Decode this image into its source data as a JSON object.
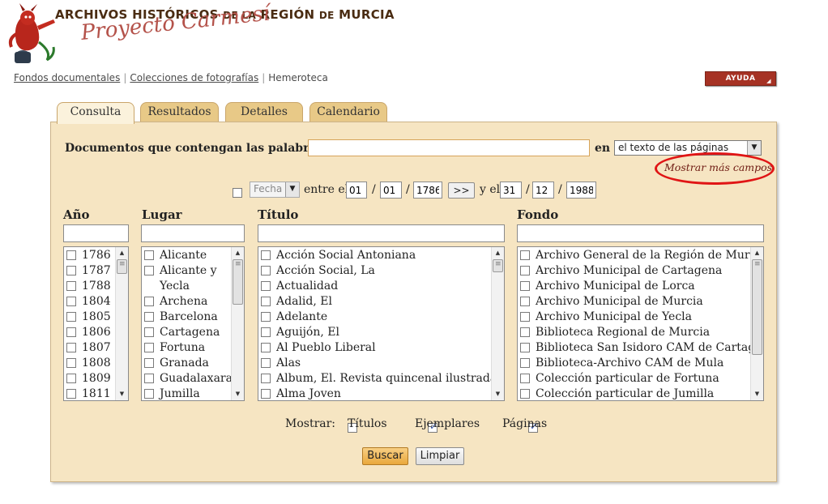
{
  "header": {
    "title_part1": "ARCHIVOS HISTÓRICOS ",
    "title_part2": "DE LA",
    "title_part3": " REGIÓN ",
    "title_part4": "DE",
    "title_part5": " MURCIA",
    "subtitle": "Proyecto Carmesí",
    "logo_icon": "devil-mascot-icon"
  },
  "nav": {
    "links": [
      "Fondos documentales",
      "Colecciones de fotografías",
      "Hemeroteca"
    ],
    "help_label": "AYUDA"
  },
  "tabs": [
    "Consulta",
    "Resultados",
    "Detalles",
    "Calendario"
  ],
  "search": {
    "label": "Documentos que contengan las palabras",
    "query": "",
    "in_label": "en",
    "scope_selected": "el texto de las páginas",
    "more_fields_link": "Mostrar más campos"
  },
  "date_filter": {
    "checked": false,
    "field_select": "Fecha",
    "between_label": "entre el",
    "from": {
      "day": "01",
      "month": "01",
      "year": "1786"
    },
    "sep": "/",
    "arrow_button": ">>",
    "and_label": "y el",
    "to": {
      "day": "31",
      "month": "12",
      "year": "1988"
    }
  },
  "columns": {
    "year": {
      "header": "Año",
      "filter": "",
      "items": [
        "1786",
        "1787",
        "1788",
        "1804",
        "1805",
        "1806",
        "1807",
        "1808",
        "1809",
        "1811"
      ]
    },
    "place": {
      "header": "Lugar",
      "filter": "",
      "items": [
        "Alicante",
        "Alicante y Yecla",
        "Archena",
        "Barcelona",
        "Cartagena",
        "Fortuna",
        "Granada",
        "Guadalaxara",
        "Jumilla"
      ]
    },
    "title": {
      "header": "Título",
      "filter": "",
      "items": [
        "Acción Social Antoniana",
        "Acción Social, La",
        "Actualidad",
        "Adalid, El",
        "Adelante",
        "Aguijón, El",
        "Al Pueblo Liberal",
        "Alas",
        "Album, El. Revista quincenal ilustrada.",
        "Alma Joven"
      ]
    },
    "collection": {
      "header": "Fondo",
      "filter": "",
      "items": [
        "Archivo General de la Región de Murcia",
        "Archivo Municipal de Cartagena",
        "Archivo Municipal de Lorca",
        "Archivo Municipal de Murcia",
        "Archivo Municipal de Yecla",
        "Biblioteca Regional de Murcia",
        "Biblioteca San Isidoro CAM de Cartagena",
        "Biblioteca-Archivo CAM de Mula",
        "Colección particular de Fortuna",
        "Colección particular de Jumilla"
      ]
    }
  },
  "show": {
    "label": "Mostrar:",
    "options": [
      {
        "label": "Títulos",
        "checked": false
      },
      {
        "label": "Ejemplares",
        "checked": true
      },
      {
        "label": "Páginas",
        "checked": true
      }
    ]
  },
  "actions": {
    "search": "Buscar",
    "clear": "Limpiar"
  },
  "colors": {
    "panel_bg": "#f6e5c2",
    "tab_bg": "#e8c987",
    "help_bg": "#a63224",
    "title_color": "#4a2c12",
    "highlight_oval": "#e01515"
  }
}
